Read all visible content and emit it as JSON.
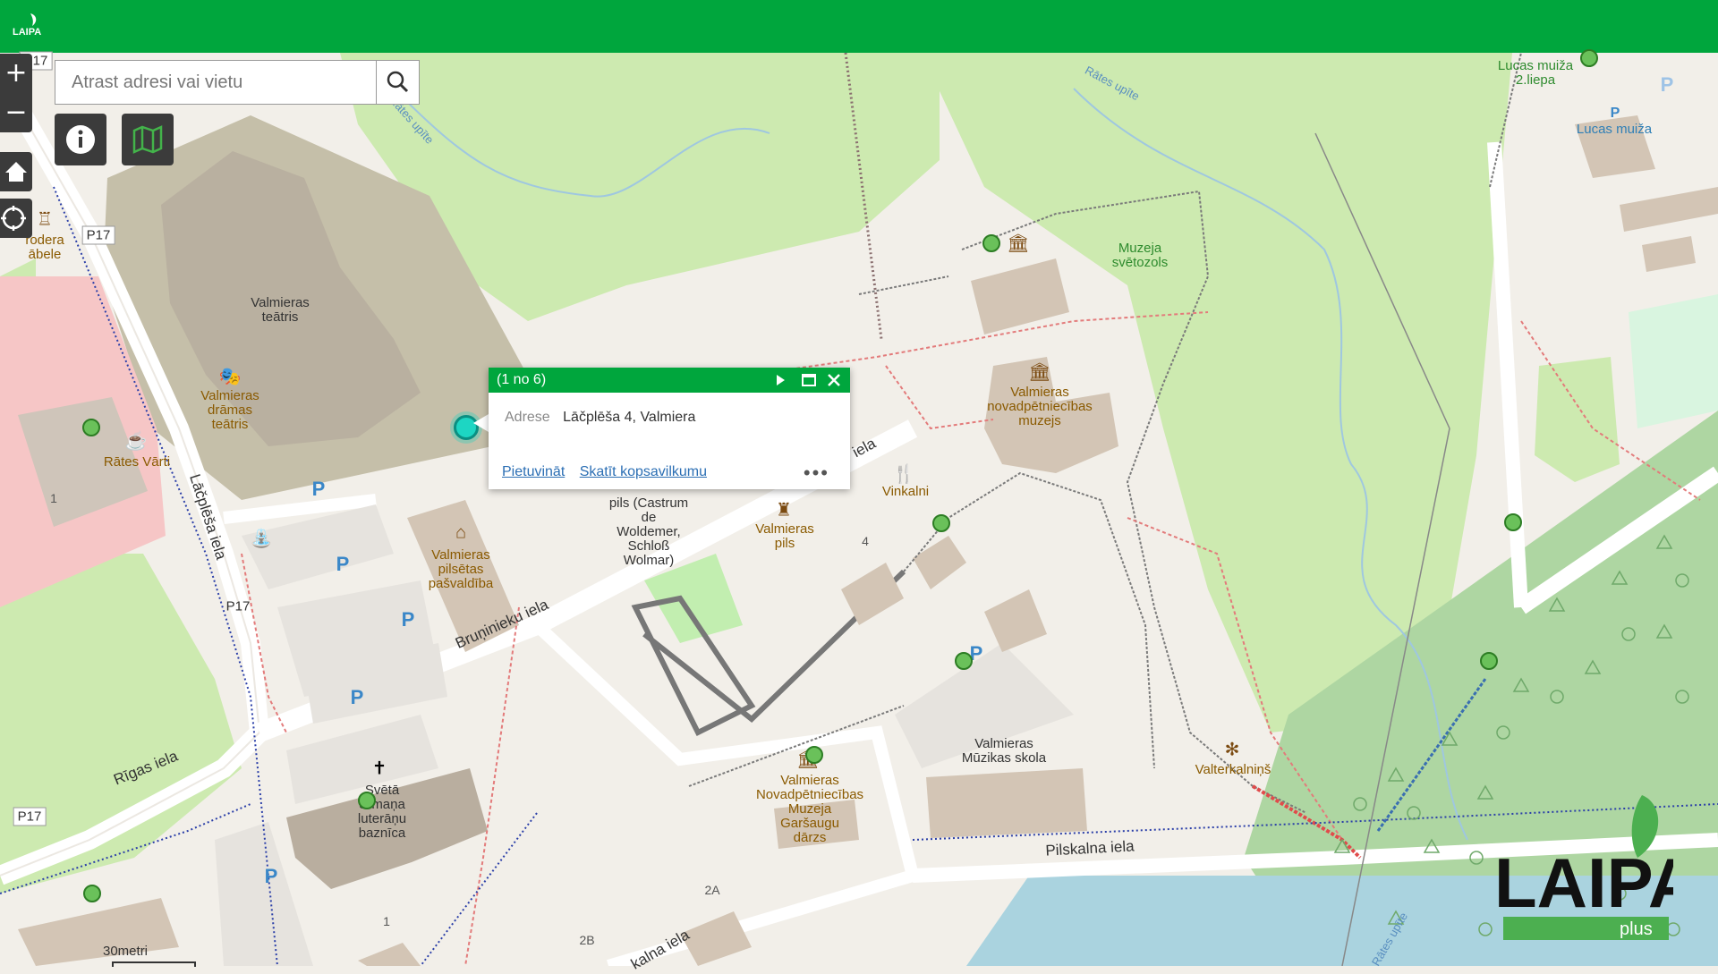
{
  "search": {
    "placeholder": "Atrast adresi vai vietu"
  },
  "icons": {
    "search": "search-icon",
    "zoom_in": "plus-icon",
    "zoom_out": "minus-icon",
    "home": "home-icon",
    "locate": "crosshair-icon",
    "info": "info-icon",
    "basemap": "map-icon",
    "popup_next": "play-icon",
    "popup_maximize": "maximize-icon",
    "popup_close": "close-icon",
    "popup_more": "ellipsis-icon"
  },
  "zoom": {
    "in_label": "+",
    "out_label": "−"
  },
  "popup": {
    "count": "(1 no 6)",
    "field_label": "Adrese",
    "field_value": "Lāčplēša 4, Valmiera",
    "action_zoom": "Pietuvināt",
    "action_summary": "Skatīt kopsavilkumu",
    "more": "•••"
  },
  "map": {
    "labels": [
      {
        "text": "Valmieras\nteātris",
        "style": ""
      },
      {
        "text": "Valmieras\ndrāmas\nteātris",
        "style": "poi"
      },
      {
        "text": "Rātes Vārti",
        "style": "poi"
      },
      {
        "text": "rodera\nābele",
        "style": "poi"
      },
      {
        "text": "Valmieras\npilsētas\npašvaldība",
        "style": "poi"
      },
      {
        "text": "pils (Castrum\nde\nWoldemer,\nSchloß\nWolmar)",
        "style": ""
      },
      {
        "text": "Valmieras\npils",
        "style": "poi"
      },
      {
        "text": "Vinkalni",
        "style": "poi"
      },
      {
        "text": "Valmieras\nnovadpētniecības\nmuzejs",
        "style": "poi"
      },
      {
        "text": "Muzeja\nsvētozols",
        "style": "green"
      },
      {
        "text": "Lucas muiža\n2.liepa",
        "style": "green"
      },
      {
        "text": "Lucas muiža",
        "style": "blue"
      },
      {
        "text": "Valmieras\nMūzikas skola",
        "style": ""
      },
      {
        "text": "Valterkalniņš",
        "style": "poi"
      },
      {
        "text": "Valmieras\nNovadpētniecības\nMuzeja\nGaršaugu\ndārzs",
        "style": "poi"
      },
      {
        "text": "Svētā\nSīmaņa\nluterāņu\nbaznīca",
        "style": ""
      }
    ],
    "streets": [
      "Lāčplēša iela",
      "Bruņinieku iela",
      "Rīgas iela",
      "Pilskalna iela",
      "Rātes upīte",
      "Rātes upīte",
      "Rātes upīte",
      "iela",
      "kalna iela"
    ],
    "road_refs": [
      "P17",
      "P17",
      "P17",
      "P17"
    ],
    "houses": [
      "1",
      "4",
      "2A",
      "1",
      "2B"
    ],
    "parking": [
      "P",
      "P",
      "P",
      "P",
      "P",
      "P",
      "P",
      "P"
    ]
  },
  "scale": {
    "label": "30metri"
  },
  "brand": {
    "name": "LAIPA",
    "suffix": "plus",
    "mini": "LAIPA"
  }
}
